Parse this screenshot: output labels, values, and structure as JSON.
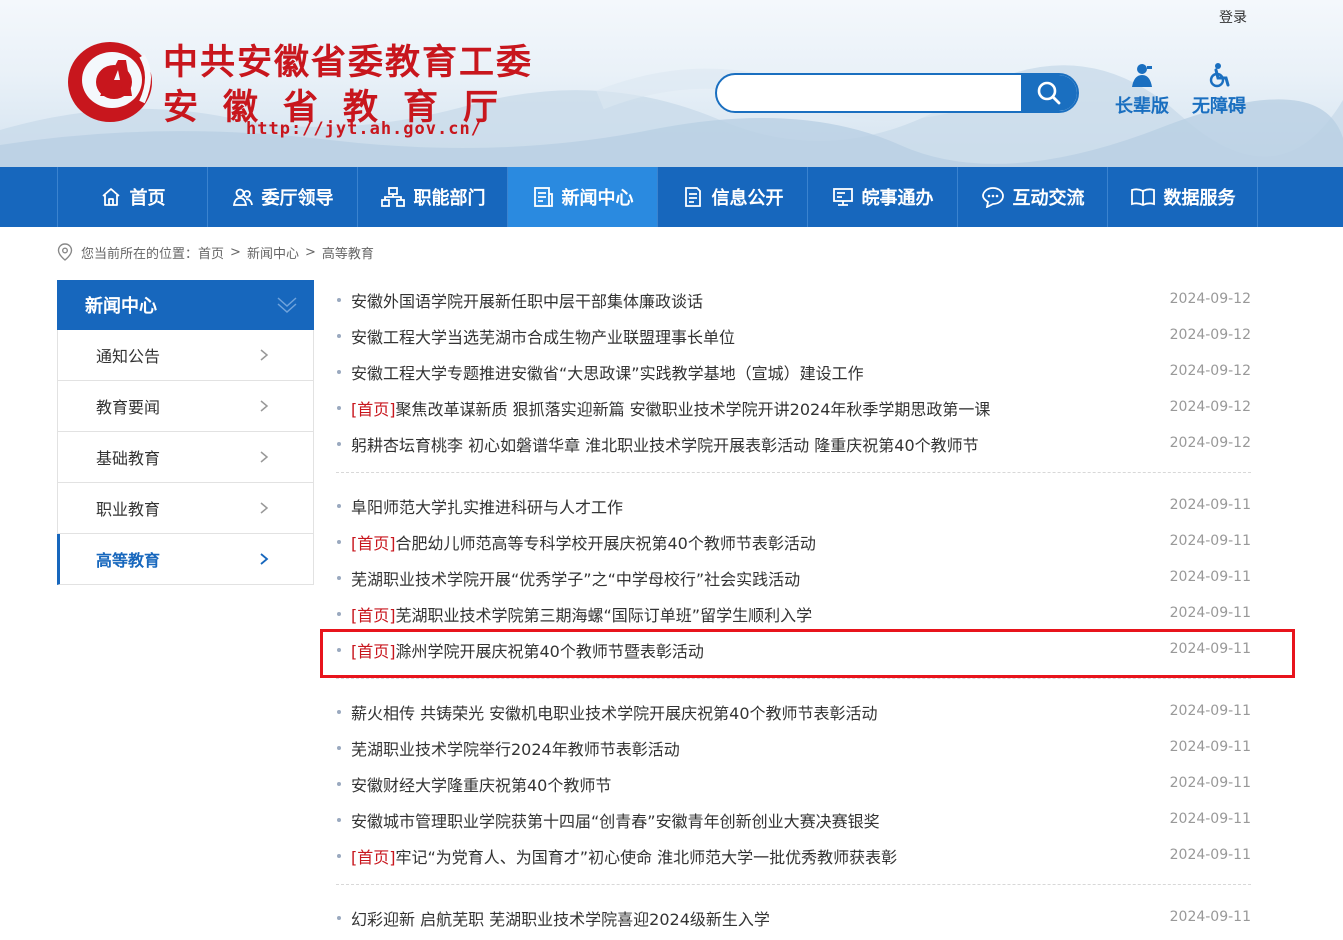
{
  "header": {
    "login": "登录",
    "logo_line1": "中共安徽省委教育工委",
    "logo_line2": "安徽省教育厅",
    "logo_url": "http://jyt.ah.gov.cn/",
    "search_placeholder": "",
    "search_icon": "search-icon",
    "tools": [
      {
        "label": "长辈版",
        "icon": "elder-icon"
      },
      {
        "label": "无障碍",
        "icon": "wheelchair-icon"
      }
    ]
  },
  "nav": [
    {
      "label": "首页",
      "icon": "home-icon"
    },
    {
      "label": "委厅领导",
      "icon": "leaders-icon"
    },
    {
      "label": "职能部门",
      "icon": "org-chart-icon"
    },
    {
      "label": "新闻中心",
      "icon": "news-icon",
      "active": true
    },
    {
      "label": "信息公开",
      "icon": "document-icon"
    },
    {
      "label": "皖事通办",
      "icon": "monitor-icon"
    },
    {
      "label": "互动交流",
      "icon": "chat-icon"
    },
    {
      "label": "数据服务",
      "icon": "book-icon"
    }
  ],
  "breadcrumb": {
    "prefix": "您当前所在的位置：",
    "items": [
      "首页",
      "新闻中心",
      "高等教育"
    ],
    "separator": ">"
  },
  "sidebar": {
    "title": "新闻中心",
    "items": [
      {
        "label": "通知公告"
      },
      {
        "label": "教育要闻"
      },
      {
        "label": "基础教育"
      },
      {
        "label": "职业教育"
      },
      {
        "label": "高等教育",
        "active": true
      }
    ]
  },
  "news": {
    "groups": [
      [
        {
          "tag": "",
          "title": "安徽外国语学院开展新任职中层干部集体廉政谈话",
          "date": "2024-09-12"
        },
        {
          "tag": "",
          "title": "安徽工程大学当选芜湖市合成生物产业联盟理事长单位",
          "date": "2024-09-12"
        },
        {
          "tag": "",
          "title": "安徽工程大学专题推进安徽省“大思政课”实践教学基地（宣城）建设工作",
          "date": "2024-09-12"
        },
        {
          "tag": "[首页]",
          "title": "聚焦改革谋新质 狠抓落实迎新篇 安徽职业技术学院开讲2024年秋季学期思政第一课",
          "date": "2024-09-12"
        },
        {
          "tag": "",
          "title": "躬耕杏坛育桃李 初心如磐谱华章 淮北职业技术学院开展表彰活动 隆重庆祝第40个教师节",
          "date": "2024-09-12"
        }
      ],
      [
        {
          "tag": "",
          "title": "阜阳师范大学扎实推进科研与人才工作",
          "date": "2024-09-11"
        },
        {
          "tag": "[首页]",
          "title": "合肥幼儿师范高等专科学校开展庆祝第40个教师节表彰活动",
          "date": "2024-09-11"
        },
        {
          "tag": "",
          "title": "芜湖职业技术学院开展“优秀学子”之“中学母校行”社会实践活动",
          "date": "2024-09-11"
        },
        {
          "tag": "[首页]",
          "title": "芜湖职业技术学院第三期海螺“国际订单班”留学生顺利入学",
          "date": "2024-09-11"
        },
        {
          "tag": "[首页]",
          "title": "滁州学院开展庆祝第40个教师节暨表彰活动",
          "date": "2024-09-11"
        }
      ],
      [
        {
          "tag": "",
          "title": "薪火相传 共铸荣光 安徽机电职业技术学院开展庆祝第40个教师节表彰活动",
          "date": "2024-09-11"
        },
        {
          "tag": "",
          "title": "芜湖职业技术学院举行2024年教师节表彰活动",
          "date": "2024-09-11"
        },
        {
          "tag": "",
          "title": "安徽财经大学隆重庆祝第40个教师节",
          "date": "2024-09-11"
        },
        {
          "tag": "",
          "title": "安徽城市管理职业学院获第十四届“创青春”安徽青年创新创业大赛决赛银奖",
          "date": "2024-09-11"
        },
        {
          "tag": "[首页]",
          "title": "牢记“为党育人、为国育才”初心使命 淮北师范大学一批优秀教师获表彰",
          "date": "2024-09-11"
        }
      ],
      [
        {
          "tag": "",
          "title": "幻彩迎新 启航芜职 芜湖职业技术学院喜迎2024级新生入学",
          "date": "2024-09-11"
        }
      ]
    ]
  },
  "colors": {
    "brand_blue": "#1767bd",
    "active_nav": "#2a8ae0",
    "logo_red": "#c8161d",
    "highlight_red": "#e8141c"
  }
}
